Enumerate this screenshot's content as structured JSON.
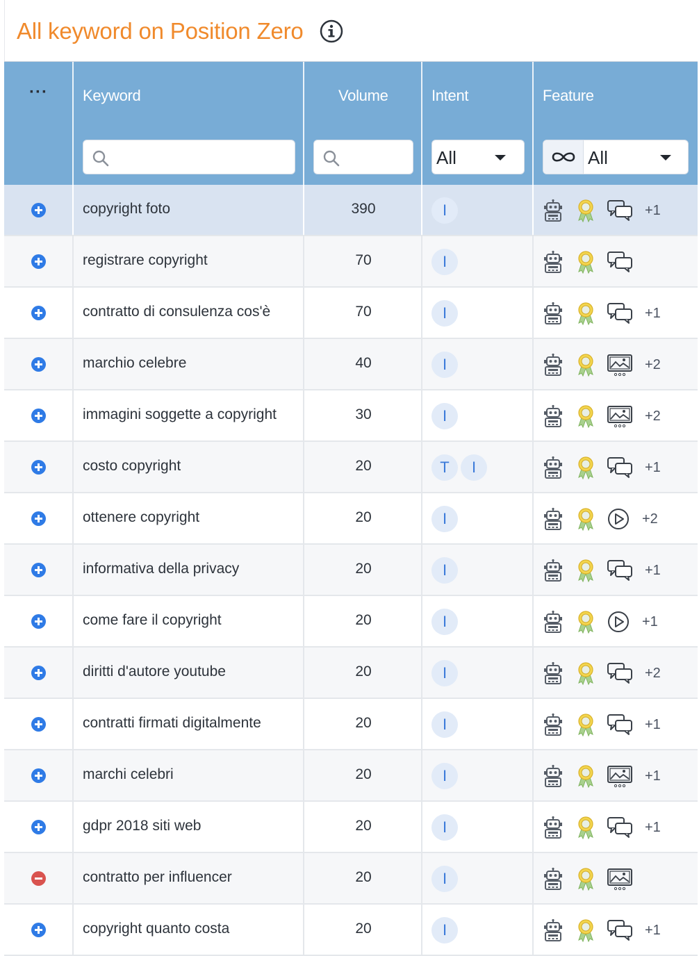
{
  "header": {
    "title": "All keyword on Position Zero",
    "info_icon": "info-circle-icon"
  },
  "table": {
    "columns": {
      "menu": "···",
      "keyword": "Keyword",
      "volume": "Volume",
      "intent": "Intent",
      "feature": "Feature"
    },
    "filters": {
      "keyword_search": {
        "placeholder": "",
        "value": ""
      },
      "volume_search": {
        "placeholder": "",
        "value": ""
      },
      "intent_select": "All",
      "feature_select": "All",
      "feature_mode_icon": "infinity-icon"
    },
    "rows": [
      {
        "keyword": "copyright foto",
        "volume": "390",
        "intents": [
          "I"
        ],
        "features": [
          "robot",
          "award",
          "chat"
        ],
        "more": "+1",
        "action": "add",
        "highlight": true
      },
      {
        "keyword": "registrare copyright",
        "volume": "70",
        "intents": [
          "I"
        ],
        "features": [
          "robot",
          "award",
          "chat"
        ],
        "more": "",
        "action": "add"
      },
      {
        "keyword": "contratto di consulenza cos'è",
        "volume": "70",
        "intents": [
          "I"
        ],
        "features": [
          "robot",
          "award",
          "chat"
        ],
        "more": "+1",
        "action": "add"
      },
      {
        "keyword": "marchio celebre",
        "volume": "40",
        "intents": [
          "I"
        ],
        "features": [
          "robot",
          "award",
          "image"
        ],
        "more": "+2",
        "action": "add"
      },
      {
        "keyword": "immagini soggette a copyright",
        "volume": "30",
        "intents": [
          "I"
        ],
        "features": [
          "robot",
          "award",
          "image"
        ],
        "more": "+2",
        "action": "add"
      },
      {
        "keyword": "costo copyright",
        "volume": "20",
        "intents": [
          "T",
          "I"
        ],
        "features": [
          "robot",
          "award",
          "chat"
        ],
        "more": "+1",
        "action": "add"
      },
      {
        "keyword": "ottenere copyright",
        "volume": "20",
        "intents": [
          "I"
        ],
        "features": [
          "robot",
          "award",
          "video"
        ],
        "more": "+2",
        "action": "add"
      },
      {
        "keyword": "informativa della privacy",
        "volume": "20",
        "intents": [
          "I"
        ],
        "features": [
          "robot",
          "award",
          "chat"
        ],
        "more": "+1",
        "action": "add"
      },
      {
        "keyword": "come fare il copyright",
        "volume": "20",
        "intents": [
          "I"
        ],
        "features": [
          "robot",
          "award",
          "video"
        ],
        "more": "+1",
        "action": "add"
      },
      {
        "keyword": "diritti d'autore youtube",
        "volume": "20",
        "intents": [
          "I"
        ],
        "features": [
          "robot",
          "award",
          "chat"
        ],
        "more": "+2",
        "action": "add"
      },
      {
        "keyword": "contratti firmati digitalmente",
        "volume": "20",
        "intents": [
          "I"
        ],
        "features": [
          "robot",
          "award",
          "chat"
        ],
        "more": "+1",
        "action": "add"
      },
      {
        "keyword": "marchi celebri",
        "volume": "20",
        "intents": [
          "I"
        ],
        "features": [
          "robot",
          "award",
          "image"
        ],
        "more": "+1",
        "action": "add"
      },
      {
        "keyword": "gdpr 2018 siti web",
        "volume": "20",
        "intents": [
          "I"
        ],
        "features": [
          "robot",
          "award",
          "chat"
        ],
        "more": "+1",
        "action": "add"
      },
      {
        "keyword": "contratto per influencer",
        "volume": "20",
        "intents": [
          "I"
        ],
        "features": [
          "robot",
          "award",
          "image"
        ],
        "more": "",
        "action": "remove"
      },
      {
        "keyword": "copyright quanto costa",
        "volume": "20",
        "intents": [
          "I"
        ],
        "features": [
          "robot",
          "award",
          "chat"
        ],
        "more": "+1",
        "action": "add"
      }
    ]
  },
  "colors": {
    "title": "#f08a2c",
    "header_bg": "#78acd6",
    "add_button": "#2f7be6",
    "remove_button": "#d9534f",
    "intent_badge_bg": "#e2ebf8",
    "intent_badge_text": "#3a7ad9",
    "highlight_row": "#d9e3f1"
  }
}
